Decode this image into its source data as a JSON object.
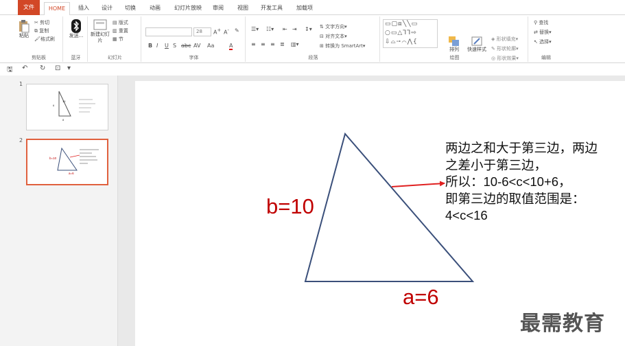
{
  "ribbon_tabs": [
    "文件",
    "HOME",
    "插入",
    "设计",
    "切换",
    "动画",
    "幻灯片放映",
    "审阅",
    "视图",
    "开发工具",
    "加载项"
  ],
  "active_tab": "HOME",
  "clipboard": {
    "paste": "粘贴",
    "cut": "剪切",
    "copy": "复制",
    "format_painter": "格式刷",
    "label": "剪贴板"
  },
  "bluetooth": {
    "send": "发送...",
    "label": "蓝牙"
  },
  "slides_group": {
    "new_slide": "新建幻灯片",
    "layout": "版式",
    "reset": "重置",
    "section": "节",
    "label": "幻灯片"
  },
  "font_group": {
    "font_name": "",
    "font_size": "28",
    "bold": "B",
    "italic": "I",
    "underline": "U",
    "shadow": "S",
    "strike": "abc",
    "spacing": "AV",
    "case": "Aa",
    "color": "A",
    "label": "字体"
  },
  "paragraph_group": {
    "text_direction": "文字方向",
    "align_text": "对齐文本",
    "smartart": "转换为 SmartArt",
    "label": "段落"
  },
  "drawing_group": {
    "arrange": "排列",
    "quick_styles": "快速样式",
    "shape_fill": "形状填充",
    "shape_outline": "形状轮廓",
    "shape_effects": "形状效果",
    "label": "绘图"
  },
  "editing_group": {
    "find": "查找",
    "replace": "替换",
    "select": "选择",
    "label": "编辑"
  },
  "quick_access": {
    "save": "🖫",
    "undo": "↶",
    "redo": "↻",
    "more": "▾"
  },
  "thumbnails": [
    {
      "number": "1",
      "selected": false
    },
    {
      "number": "2",
      "selected": true
    }
  ],
  "slide": {
    "label_b": "b=10",
    "label_a": "a=6",
    "text_lines": [
      "两边之和大于第三边，两边",
      "之差小于第三边，",
      "所以：10-6<c<10+6，",
      "即第三边的取值范围是：",
      "4<c<16"
    ],
    "label_color": "#c00000",
    "triangle_color": "#3a4f7a",
    "arrow_color": "#e02020"
  },
  "watermark": "最需教育",
  "colors": {
    "accent": "#d24726"
  }
}
